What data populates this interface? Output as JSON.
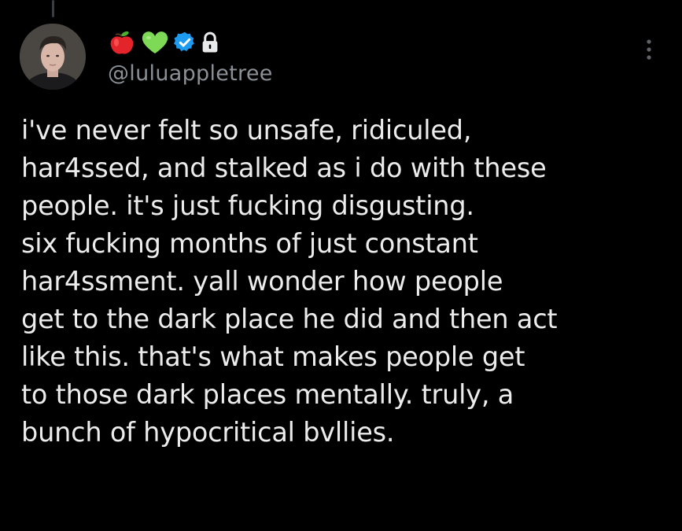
{
  "tweet": {
    "handle": "@luluappletree",
    "name_icons": [
      "apple-icon",
      "green-heart-icon",
      "verified-badge-icon",
      "lock-icon"
    ],
    "text": "i've never felt so unsafe, ridiculed,\nhar4ssed, and stalked as i do with these\npeople. it's just fucking disgusting.\nsix fucking months of just constant\nhar4ssment. yall wonder how people\nget to the dark place he did and then act\nlike this. that's what makes people get\nto those dark places mentally. truly, a\nbunch of hypocritical bvllies.",
    "meta": "",
    "more_icon": "more-vertical-icon"
  },
  "colors": {
    "background": "#000000",
    "text": "#e7e9ea",
    "secondary": "#8b9096",
    "verified": "#1d9bf0",
    "apple": "#e8262b",
    "heart": "#7ed957"
  }
}
